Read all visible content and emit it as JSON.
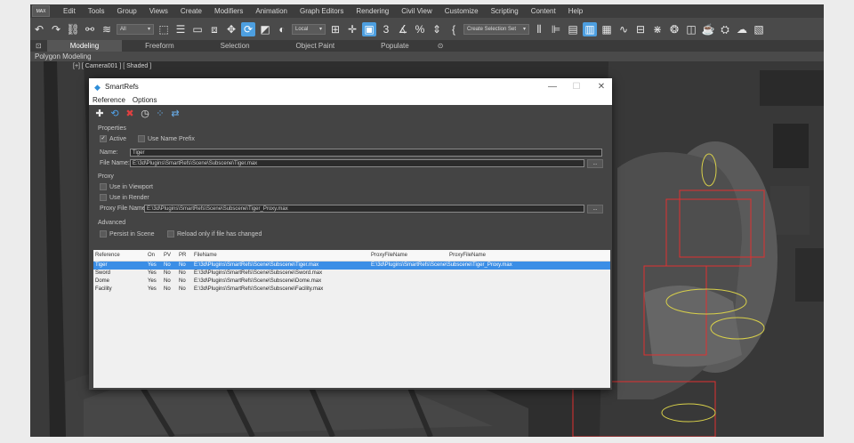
{
  "app": {
    "menu": [
      "Edit",
      "Tools",
      "Group",
      "Views",
      "Create",
      "Modifiers",
      "Animation",
      "Graph Editors",
      "Rendering",
      "Civil View",
      "Customize",
      "Scripting",
      "Content",
      "Help"
    ],
    "toolbar": {
      "filter_value": "All",
      "coord_value": "Local",
      "selection_set": "Create Selection Set"
    },
    "ribbon_tabs": [
      "Modeling",
      "Freeform",
      "Selection",
      "Object Paint",
      "Populate"
    ],
    "ribbon_sub": "Polygon Modeling",
    "viewport_label": "[+] [ Camera001 ] [ Shaded ]"
  },
  "dialog": {
    "title": "SmartRefs",
    "menu": [
      "Reference",
      "Options"
    ],
    "properties": {
      "header": "Properties",
      "active_label": "Active",
      "use_name_prefix_label": "Use Name Prefix",
      "name_label": "Name:",
      "name_value": "Tiger",
      "file_name_label": "File Name:",
      "file_name_value": "E:\\3d\\Plugins\\SmartRefs\\Scene\\Subscene\\Tiger.max",
      "browse_label": "..."
    },
    "proxy": {
      "header": "Proxy",
      "use_in_viewport_label": "Use in Viewport",
      "use_in_render_label": "Use in Render",
      "proxy_file_label": "Proxy File Name:",
      "proxy_file_value": "E:\\3d\\Plugins\\SmartRefs\\Scene\\Subscene\\Tiger_Proxy.max",
      "browse_label": "..."
    },
    "advanced": {
      "header": "Advanced",
      "persist_label": "Persist in Scene",
      "reload_label": "Reload only if file has changed"
    },
    "table": {
      "columns": [
        "Reference",
        "On",
        "PV",
        "PR",
        "FileName",
        "ProxyFileName",
        "ProxyFileName"
      ],
      "rows": [
        {
          "ref": "Tiger",
          "on": "Yes",
          "pv": "No",
          "pr": "No",
          "file": "E:\\3d\\Plugins\\SmartRefs\\Scene\\Subscene\\Tiger.max",
          "proxy": "E:\\3d\\Plugins\\SmartRefs\\Scene\\Subscene\\Tiger_Proxy.max"
        },
        {
          "ref": "Sword",
          "on": "Yes",
          "pv": "No",
          "pr": "No",
          "file": "E:\\3d\\Plugins\\SmartRefs\\Scene\\Subscene\\Sword.max",
          "proxy": ""
        },
        {
          "ref": "Dome",
          "on": "Yes",
          "pv": "No",
          "pr": "No",
          "file": "E:\\3d\\Plugins\\SmartRefs\\Scene\\Subscene\\Dome.max",
          "proxy": ""
        },
        {
          "ref": "Facility",
          "on": "Yes",
          "pv": "No",
          "pr": "No",
          "file": "E:\\3d\\Plugins\\SmartRefs\\Scene\\Subscene\\Facility.max",
          "proxy": ""
        }
      ]
    }
  },
  "colors": {
    "accent": "#3b8ee6",
    "titlebar": "#ffffff",
    "panel": "#444444",
    "bbox_red": "#e03030",
    "gizmo_yellow": "#d8d04a"
  },
  "icons": [
    "undo-icon",
    "redo-icon",
    "link-icon",
    "unlink-icon",
    "select-icon",
    "move-icon",
    "rotate-icon",
    "scale-icon",
    "snap-icon",
    "percent-snap-icon",
    "spinner-snap-icon",
    "mirror-icon",
    "align-icon",
    "layer-icon",
    "render-icon",
    "add-icon",
    "refresh-icon",
    "delete-icon",
    "history-icon",
    "select-nodes-icon",
    "swap-icon",
    "close-icon",
    "minimize-icon",
    "maximize-icon"
  ]
}
